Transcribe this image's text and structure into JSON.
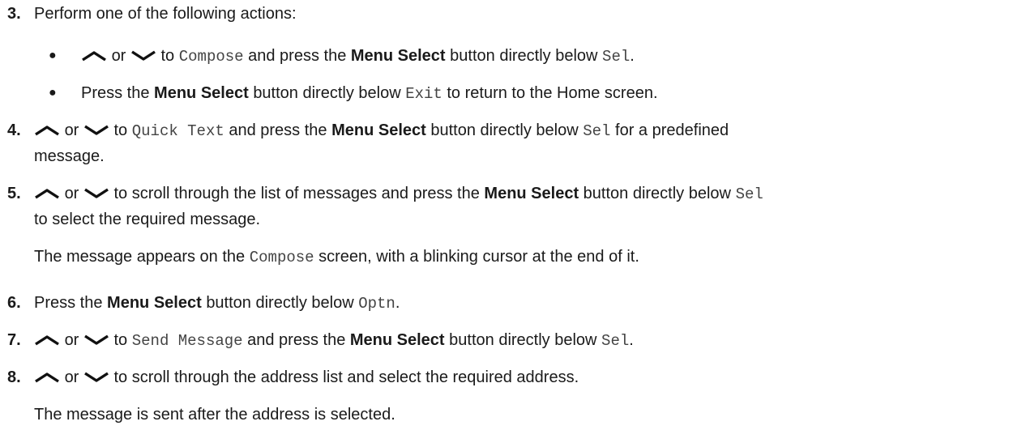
{
  "steps": [
    {
      "number": "3.",
      "text": "Perform one of the following actions:"
    },
    {
      "number": "4.",
      "mid": "or",
      "to": "to",
      "code": "Quick Text",
      "and_press": "and press the",
      "bold": "Menu Select",
      "below": "button directly below",
      "code2": "Sel",
      "rest": "for a predefined",
      "line2": "message."
    },
    {
      "number": "5.",
      "mid": "or",
      "to": "to scroll through the list of messages and press the",
      "bold": "Menu Select",
      "below": "button directly below",
      "code2": "Sel",
      "line2": "to select the required message.",
      "note": "The message appears on the",
      "note_code": "Compose",
      "note_rest": "screen, with a blinking cursor at the end of it."
    },
    {
      "number": "6.",
      "press": "Press the",
      "bold": "Menu Select",
      "below": "button directly below",
      "code": "Optn",
      "dot": "."
    },
    {
      "number": "7.",
      "mid": "or",
      "to": "to",
      "code": "Send Message",
      "and_press": "and press the",
      "bold": "Menu Select",
      "below": "button directly below",
      "code2": "Sel",
      "dot": "."
    },
    {
      "number": "8.",
      "mid": "or",
      "text": "to scroll through the address list and select the required address.",
      "note": "The message is sent after the address is selected."
    }
  ],
  "bullets": [
    {
      "symbol": "●",
      "mid": "or",
      "to": "to",
      "code": "Compose",
      "and_press": "and press the",
      "bold": "Menu Select",
      "below": "button directly below",
      "code2": "Sel",
      "dot": "."
    },
    {
      "symbol": "●",
      "press": "Press the",
      "bold": "Menu Select",
      "below": "button directly below",
      "code": "Exit",
      "rest": "to return to the Home screen."
    }
  ],
  "icons": {
    "up": "chevron-up-icon",
    "down": "chevron-down-icon"
  }
}
